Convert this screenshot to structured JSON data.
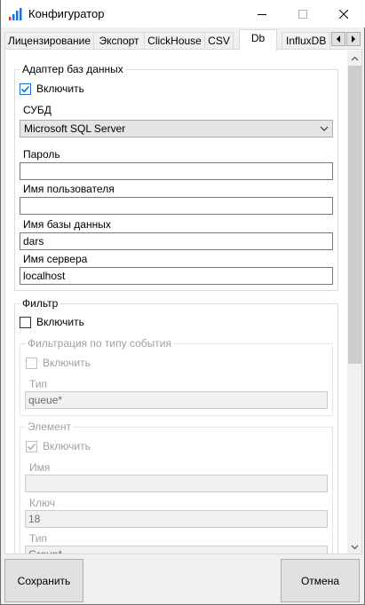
{
  "window": {
    "title": "Конфигуратор",
    "icons": {
      "app": "bar-chart-icon",
      "minimize": "minimize-icon",
      "maximize": "maximize-icon",
      "close": "close-icon"
    }
  },
  "tabs": [
    {
      "label": "Лицензирование"
    },
    {
      "label": "Экспорт"
    },
    {
      "label": "ClickHouse"
    },
    {
      "label": "CSV"
    },
    {
      "label": "Db"
    },
    {
      "label": "InfluxDB"
    }
  ],
  "active_tab": "Db",
  "db_adapter": {
    "title": "Адаптер баз данных",
    "enable_label": "Включить",
    "enabled": true,
    "dbms_label": "СУБД",
    "dbms_value": "Microsoft SQL Server",
    "password_label": "Пароль",
    "password_value": "",
    "username_label": "Имя пользователя",
    "username_value": "",
    "dbname_label": "Имя базы данных",
    "dbname_value": "dars",
    "server_label": "Имя сервера",
    "server_value": "localhost"
  },
  "filter": {
    "title": "Фильтр",
    "enable_label": "Включить",
    "enabled": false,
    "event_type": {
      "title": "Фильтрация по типу события",
      "enable_label": "Включить",
      "enabled": false,
      "type_label": "Тип",
      "type_value": "queue*"
    },
    "element": {
      "title": "Элемент",
      "enable_label": "Включить",
      "enabled": true,
      "name_label": "Имя",
      "name_value": "",
      "key_label": "Ключ",
      "key_value": "18",
      "type_label": "Тип",
      "type_value": "Group*"
    }
  },
  "buttons": {
    "save": "Сохранить",
    "cancel": "Отмена"
  },
  "colors": {
    "accent": "#1e6fd9",
    "icon_red": "#e0302a",
    "icon_blue": "#1e6fd9"
  }
}
